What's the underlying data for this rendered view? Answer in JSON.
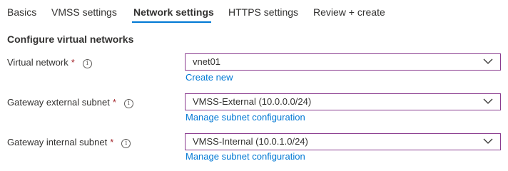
{
  "tabs": [
    {
      "label": "Basics",
      "active": false
    },
    {
      "label": "VMSS settings",
      "active": false
    },
    {
      "label": "Network settings",
      "active": true
    },
    {
      "label": "HTTPS settings",
      "active": false
    },
    {
      "label": "Review + create",
      "active": false
    }
  ],
  "section_title": "Configure virtual networks",
  "fields": [
    {
      "label": "Virtual network",
      "required": "*",
      "value": "vnet01",
      "link": "Create new"
    },
    {
      "label": "Gateway external subnet",
      "required": "*",
      "value": "VMSS-External (10.0.0.0/24)",
      "link": "Manage subnet configuration"
    },
    {
      "label": "Gateway internal subnet",
      "required": "*",
      "value": "VMSS-Internal (10.0.1.0/24)",
      "link": "Manage subnet configuration"
    }
  ],
  "info_glyph": "i",
  "colors": {
    "accent": "#0078d4",
    "required": "#a4262c",
    "field_border": "#8a3b8f",
    "text": "#323130"
  }
}
